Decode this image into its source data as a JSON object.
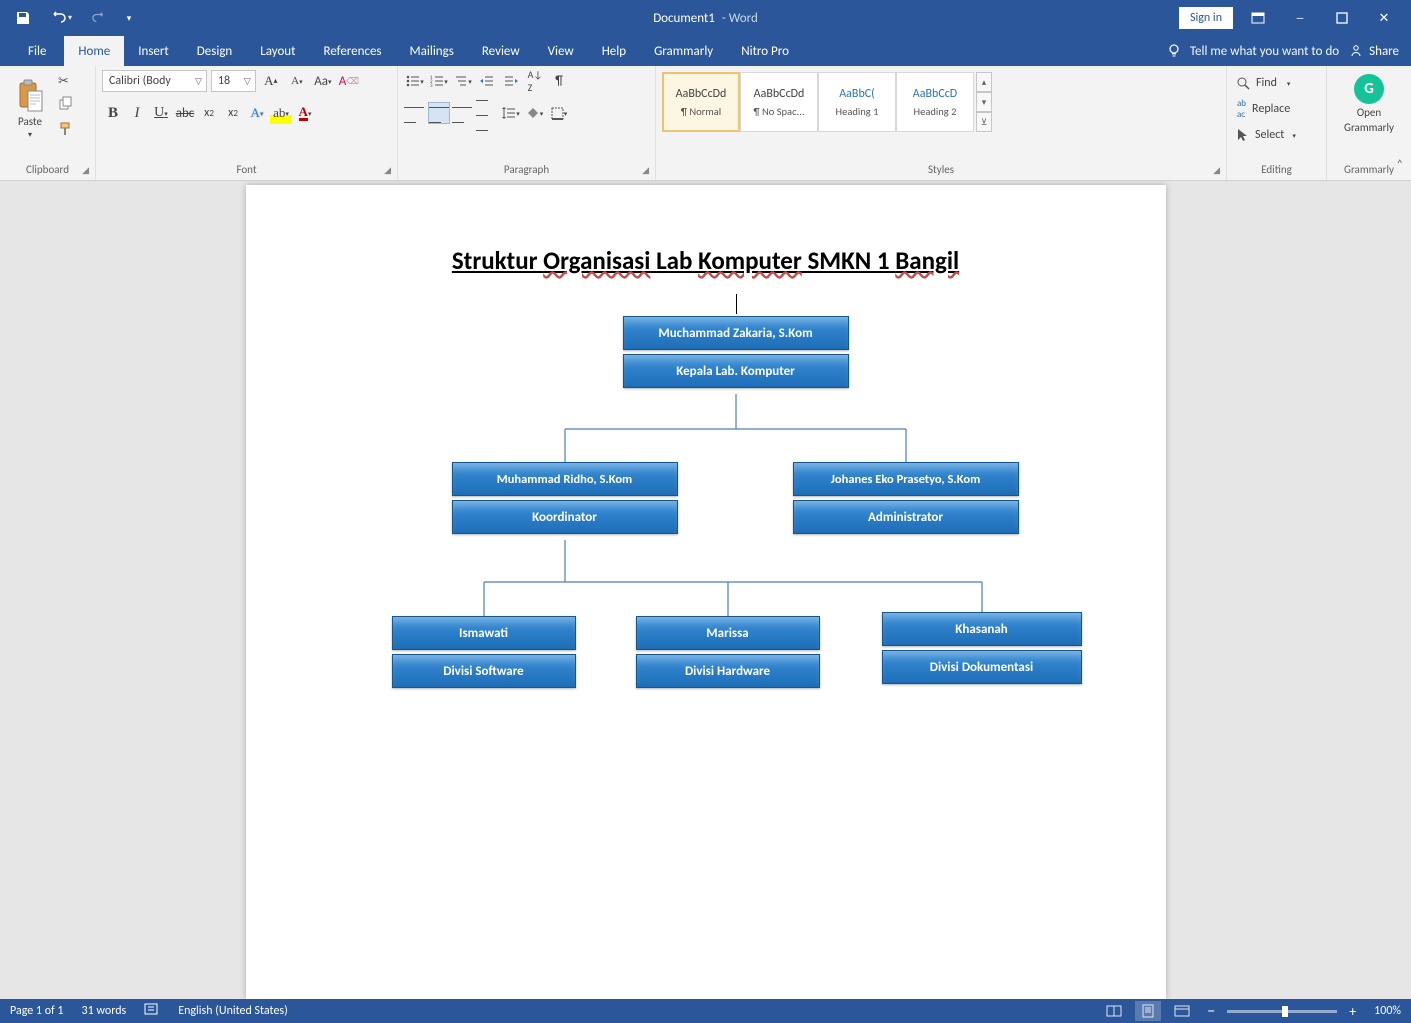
{
  "titlebar": {
    "doc_name": "Document1",
    "app_suffix": "-  Word",
    "signin": "Sign in"
  },
  "tabs": {
    "file": "File",
    "home": "Home",
    "insert": "Insert",
    "design": "Design",
    "layout": "Layout",
    "references": "References",
    "mailings": "Mailings",
    "review": "Review",
    "view": "View",
    "help": "Help",
    "grammarly": "Grammarly",
    "nitro": "Nitro Pro",
    "tellme": "Tell me what you want to do",
    "share": "Share"
  },
  "ribbon": {
    "clipboard": {
      "paste": "Paste",
      "label": "Clipboard"
    },
    "font": {
      "name_value": "Calibri (Body",
      "size_value": "18",
      "label": "Font"
    },
    "paragraph": {
      "label": "Paragraph"
    },
    "styles": {
      "label": "Styles",
      "tiles": [
        {
          "preview": "AaBbCcDd",
          "name": "¶ Normal",
          "cls": ""
        },
        {
          "preview": "AaBbCcDd",
          "name": "¶ No Spac...",
          "cls": ""
        },
        {
          "preview": "AaBbC(",
          "name": "Heading 1",
          "cls": "h1p"
        },
        {
          "preview": "AaBbCcD",
          "name": "Heading 2",
          "cls": "h2p"
        }
      ]
    },
    "editing": {
      "find": "Find",
      "replace": "Replace",
      "select": "Select",
      "label": "Editing"
    },
    "grammarly": {
      "line1": "Open",
      "line2": "Grammarly",
      "label": "Grammarly"
    }
  },
  "document": {
    "title_plain_1": "Struktur",
    "title_sq_1": "Organisasi",
    "title_plain_2": "Lab",
    "title_sq_2": "Komputer",
    "title_plain_3": "SMKN 1",
    "title_sq_3": "Bangil",
    "org": {
      "head_name": "Muchammad Zakaria, S.Kom",
      "head_role": "Kepala Lab. Komputer",
      "l2": [
        {
          "name": "Muhammad Ridho, S.Kom",
          "role": "Koordinator"
        },
        {
          "name": "Johanes Eko Prasetyo, S.Kom",
          "role": "Administrator"
        }
      ],
      "l3": [
        {
          "name": "Ismawati",
          "role": "Divisi  Software"
        },
        {
          "name": "Marissa",
          "role": "Divisi  Hardware"
        },
        {
          "name": "Khasanah",
          "role": "Divisi  Dokumentasi"
        }
      ]
    }
  },
  "status": {
    "page": "Page 1 of 1",
    "words": "31 words",
    "lang": "English (United States)",
    "zoom": "100%"
  }
}
